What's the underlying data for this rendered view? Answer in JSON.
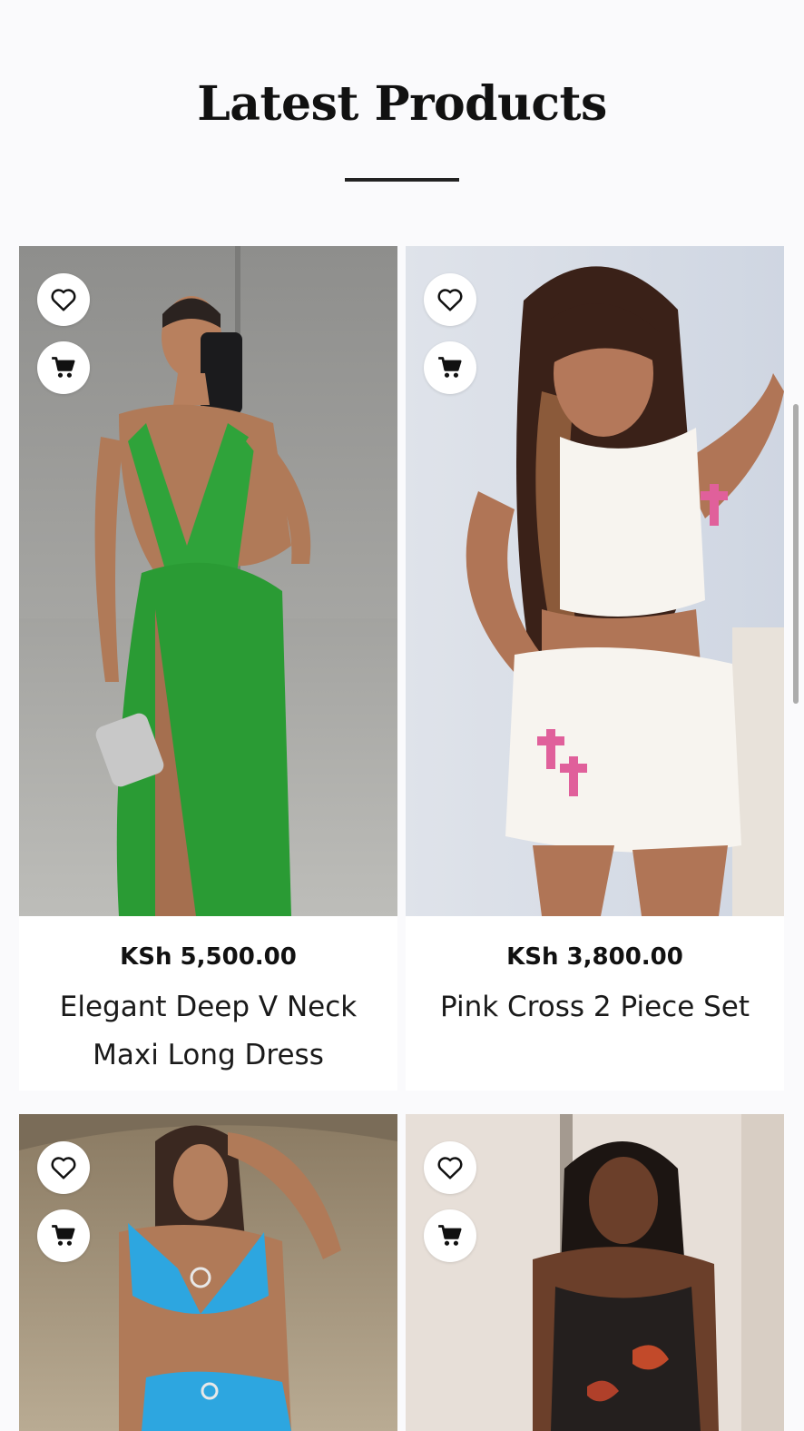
{
  "section": {
    "title": "Latest Products"
  },
  "icons": {
    "wishlist": "heart-outline-icon",
    "cart": "shopping-cart-icon"
  },
  "colors": {
    "background": "#fafafc",
    "title": "#111111",
    "card": "#ffffff"
  },
  "products": [
    {
      "price": "KSh 5,500.00",
      "name": "Elegant Deep V Neck Maxi Long Dress",
      "image": "woman in green deep v-neck maxi dress taking mirror selfie"
    },
    {
      "price": "KSh 3,800.00",
      "name": "Pink Cross 2 Piece Set",
      "image": "woman in white crop top and mini skirt with pink cross prints"
    },
    {
      "price": "",
      "name": "",
      "image": "woman in blue cut-out two piece set in desert"
    },
    {
      "price": "",
      "name": "",
      "image": "woman in dark floral bodycon dress"
    }
  ]
}
